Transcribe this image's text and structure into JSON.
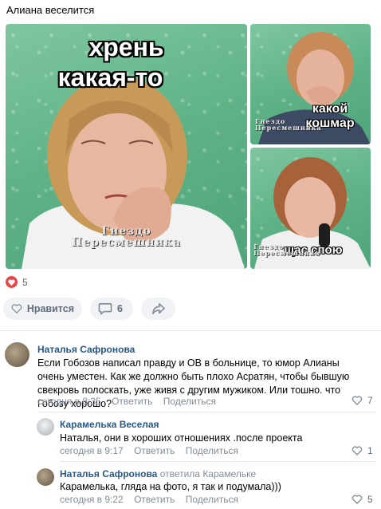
{
  "post": {
    "text": "Алиана веселится",
    "photos": [
      {
        "caption_line1": "хрень",
        "caption_line2": "какая-то",
        "watermark_line1": "Гнездо",
        "watermark_line2": "Пересмешника"
      },
      {
        "caption_line1": "какой",
        "caption_line2": "кошмар",
        "watermark_line1": "Гнездо",
        "watermark_line2": "Пересмешника"
      },
      {
        "caption_line1": "щас спою",
        "watermark_line1": "Гнездо",
        "watermark_line2": "Пересмешника"
      }
    ],
    "reactions_count": "5",
    "like_label": "Нравится",
    "comments_count": "6",
    "accent_color": "#e64646"
  },
  "comments": [
    {
      "author": "Наталья Сафронова",
      "text": "Если Гобозов написал правду и ОВ в больнице, то юмор Алианы очень уместен. Как же должно быть плохо Асратян, чтобы бывшую свекровь полоскать, уже живя с другим мужиком. Или тошно. что Гобозу хорошо?",
      "time": "сегодня в 8:35",
      "reply_label": "Ответить",
      "share_label": "Поделиться",
      "likes": "7"
    },
    {
      "author": "Карамелька Веселая",
      "text": "Наталья, они в хороших отношениях .после проекта",
      "time": "сегодня в 9:17",
      "reply_label": "Ответить",
      "share_label": "Поделиться",
      "likes": "1"
    },
    {
      "author": "Наталья Сафронова",
      "reply_to": "ответила Карамельке",
      "text": "Карамелька, гляда на фото, я так и подумала)))",
      "time": "сегодня в 9:22",
      "reply_label": "Ответить",
      "share_label": "Поделиться",
      "likes": "5"
    }
  ]
}
